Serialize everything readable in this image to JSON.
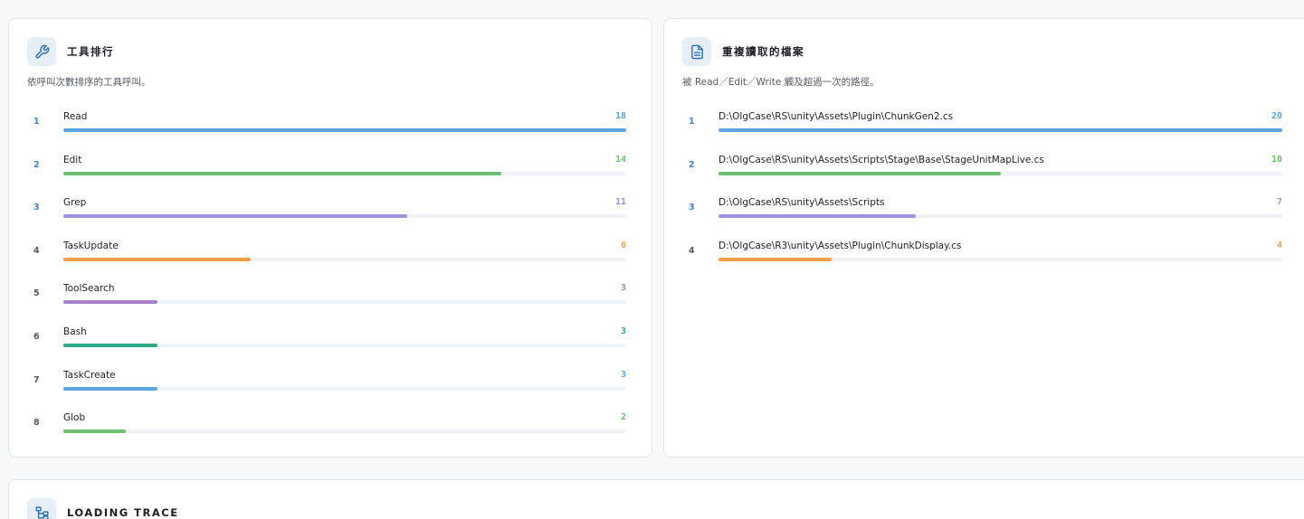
{
  "tools_card": {
    "title": "工具排行",
    "description": "依呼叫次數排序的工具呼叫。",
    "max": 18,
    "items": [
      {
        "rank": "1",
        "name": "Read",
        "count": 18,
        "color": "#5da5e0"
      },
      {
        "rank": "2",
        "name": "Edit",
        "count": 14,
        "color": "#6cc070"
      },
      {
        "rank": "3",
        "name": "Grep",
        "count": 11,
        "color": "#9c95dc"
      },
      {
        "rank": "4",
        "name": "TaskUpdate",
        "count": 6,
        "color": "#f4a04a"
      },
      {
        "rank": "5",
        "name": "ToolSearch",
        "count": 3,
        "color": "#a680c8"
      },
      {
        "rank": "6",
        "name": "Bash",
        "count": 3,
        "color": "#2aaa80"
      },
      {
        "rank": "7",
        "name": "TaskCreate",
        "count": 3,
        "color": "#5da5e0"
      },
      {
        "rank": "8",
        "name": "Glob",
        "count": 2,
        "color": "#6cc070"
      }
    ]
  },
  "files_card": {
    "title": "重複讀取的檔案",
    "description": "被 Read／Edit／Write 觸及超過一次的路徑。",
    "max": 20,
    "items": [
      {
        "rank": "1",
        "path": "D:\\OlgCase\\RS\\unity\\Assets\\Plugin\\ChunkGen2.cs",
        "count": 20,
        "color": "#5da5e0"
      },
      {
        "rank": "2",
        "path": "D:\\OlgCase\\RS\\unity\\Assets\\Scripts\\Stage\\Base\\StageUnitMapLive.cs",
        "count": 10,
        "color": "#6cc070"
      },
      {
        "rank": "3",
        "path": "D:\\OlgCase\\RS\\unity\\Assets\\Scripts",
        "count": 7,
        "color": "#9c95dc"
      },
      {
        "rank": "4",
        "path": "D:\\OlgCase\\R3\\unity\\Assets\\Plugin\\ChunkDisplay.cs",
        "count": 4,
        "color": "#f4a04a"
      }
    ]
  },
  "trace_card": {
    "title": "LOADING TRACE"
  },
  "colors": {
    "icon_bg": "#e6eef8",
    "icon_stroke": "#2f6fb5",
    "rank_color": "#4a7fc0"
  }
}
